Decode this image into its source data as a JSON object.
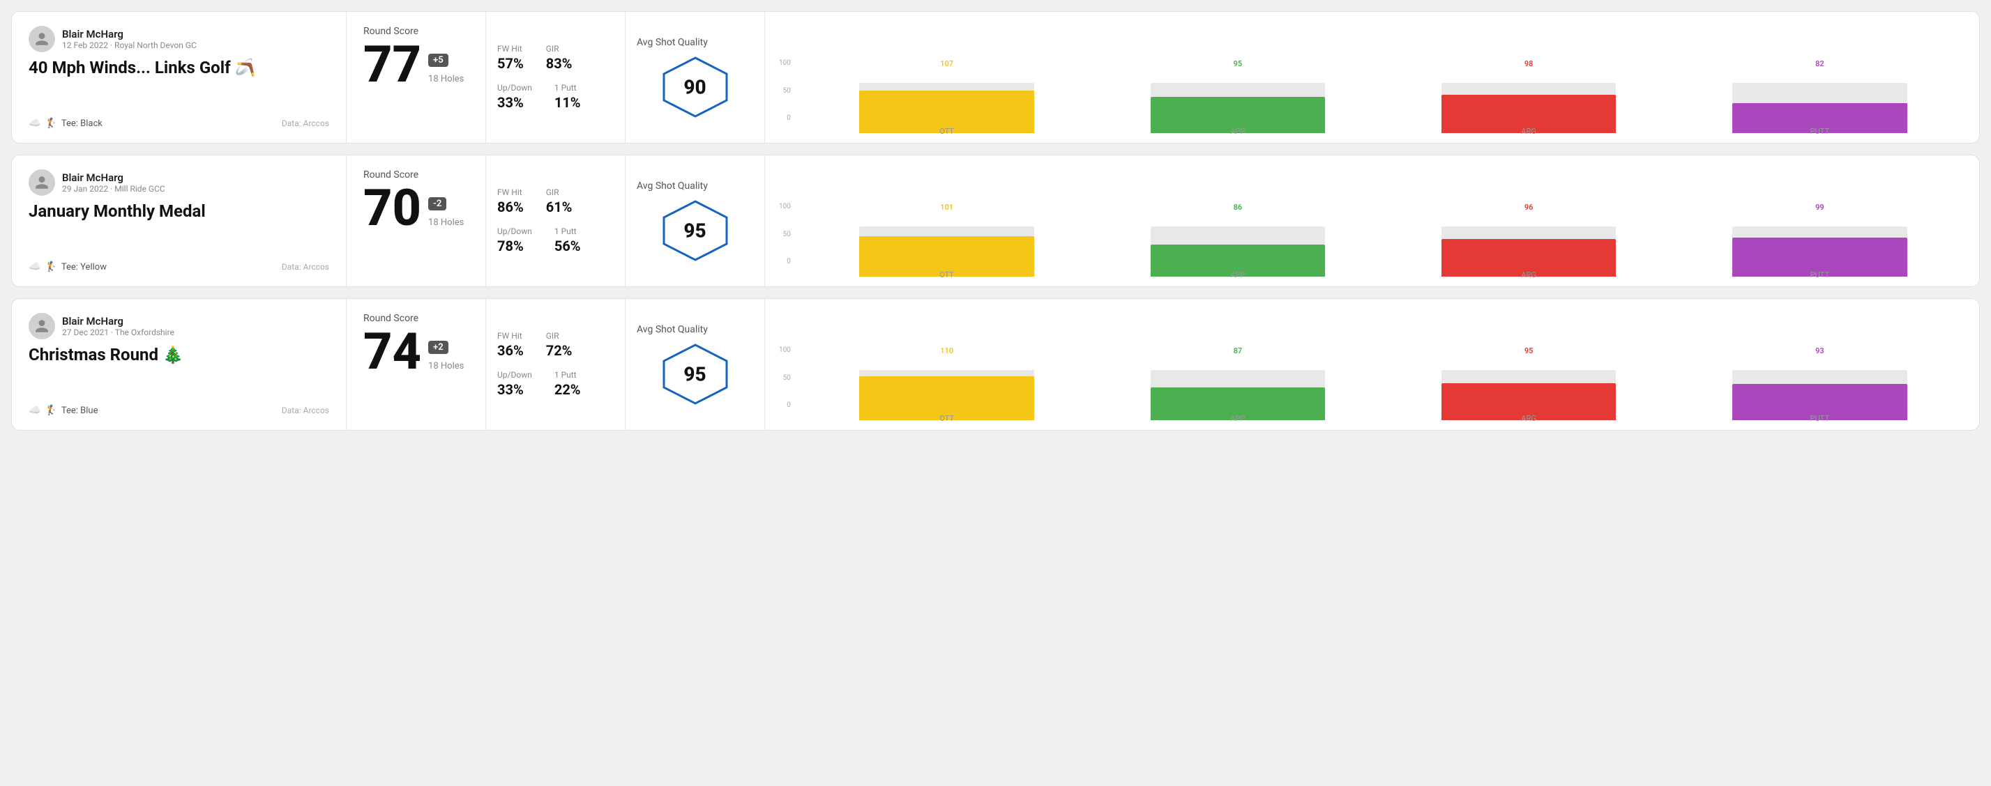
{
  "rounds": [
    {
      "id": "round1",
      "user": {
        "name": "Blair McHarg",
        "date": "12 Feb 2022 · Royal North Devon GC"
      },
      "title": "40 Mph Winds... Links Golf 🪃",
      "tee": "Black",
      "data_source": "Data: Arccos",
      "score": {
        "label": "Round Score",
        "value": "77",
        "modifier": "+5",
        "holes": "18 Holes"
      },
      "stats": {
        "fw_hit_label": "FW Hit",
        "fw_hit_value": "57%",
        "gir_label": "GIR",
        "gir_value": "83%",
        "updown_label": "Up/Down",
        "updown_value": "33%",
        "one_putt_label": "1 Putt",
        "one_putt_value": "11%"
      },
      "quality": {
        "label": "Avg Shot Quality",
        "value": "90"
      },
      "chart": {
        "bars": [
          {
            "label": "OTT",
            "value": 107,
            "color": "#f5c518",
            "fill_pct": 85
          },
          {
            "label": "APP",
            "value": 95,
            "color": "#4caf50",
            "fill_pct": 72
          },
          {
            "label": "ARG",
            "value": 98,
            "color": "#e53935",
            "fill_pct": 76
          },
          {
            "label": "PUTT",
            "value": 82,
            "color": "#ab47bc",
            "fill_pct": 60
          }
        ],
        "y_labels": [
          "100",
          "50",
          "0"
        ]
      }
    },
    {
      "id": "round2",
      "user": {
        "name": "Blair McHarg",
        "date": "29 Jan 2022 · Mill Ride GCC"
      },
      "title": "January Monthly Medal",
      "tee": "Yellow",
      "data_source": "Data: Arccos",
      "score": {
        "label": "Round Score",
        "value": "70",
        "modifier": "-2",
        "holes": "18 Holes"
      },
      "stats": {
        "fw_hit_label": "FW Hit",
        "fw_hit_value": "86%",
        "gir_label": "GIR",
        "gir_value": "61%",
        "updown_label": "Up/Down",
        "updown_value": "78%",
        "one_putt_label": "1 Putt",
        "one_putt_value": "56%"
      },
      "quality": {
        "label": "Avg Shot Quality",
        "value": "95"
      },
      "chart": {
        "bars": [
          {
            "label": "OTT",
            "value": 101,
            "color": "#f5c518",
            "fill_pct": 80
          },
          {
            "label": "APP",
            "value": 86,
            "color": "#4caf50",
            "fill_pct": 64
          },
          {
            "label": "ARG",
            "value": 96,
            "color": "#e53935",
            "fill_pct": 75
          },
          {
            "label": "PUTT",
            "value": 99,
            "color": "#ab47bc",
            "fill_pct": 78
          }
        ],
        "y_labels": [
          "100",
          "50",
          "0"
        ]
      }
    },
    {
      "id": "round3",
      "user": {
        "name": "Blair McHarg",
        "date": "27 Dec 2021 · The Oxfordshire"
      },
      "title": "Christmas Round 🎄",
      "tee": "Blue",
      "data_source": "Data: Arccos",
      "score": {
        "label": "Round Score",
        "value": "74",
        "modifier": "+2",
        "holes": "18 Holes"
      },
      "stats": {
        "fw_hit_label": "FW Hit",
        "fw_hit_value": "36%",
        "gir_label": "GIR",
        "gir_value": "72%",
        "updown_label": "Up/Down",
        "updown_value": "33%",
        "one_putt_label": "1 Putt",
        "one_putt_value": "22%"
      },
      "quality": {
        "label": "Avg Shot Quality",
        "value": "95"
      },
      "chart": {
        "bars": [
          {
            "label": "OTT",
            "value": 110,
            "color": "#f5c518",
            "fill_pct": 88
          },
          {
            "label": "APP",
            "value": 87,
            "color": "#4caf50",
            "fill_pct": 65
          },
          {
            "label": "ARG",
            "value": 95,
            "color": "#e53935",
            "fill_pct": 74
          },
          {
            "label": "PUTT",
            "value": 93,
            "color": "#ab47bc",
            "fill_pct": 72
          }
        ],
        "y_labels": [
          "100",
          "50",
          "0"
        ]
      }
    }
  ]
}
